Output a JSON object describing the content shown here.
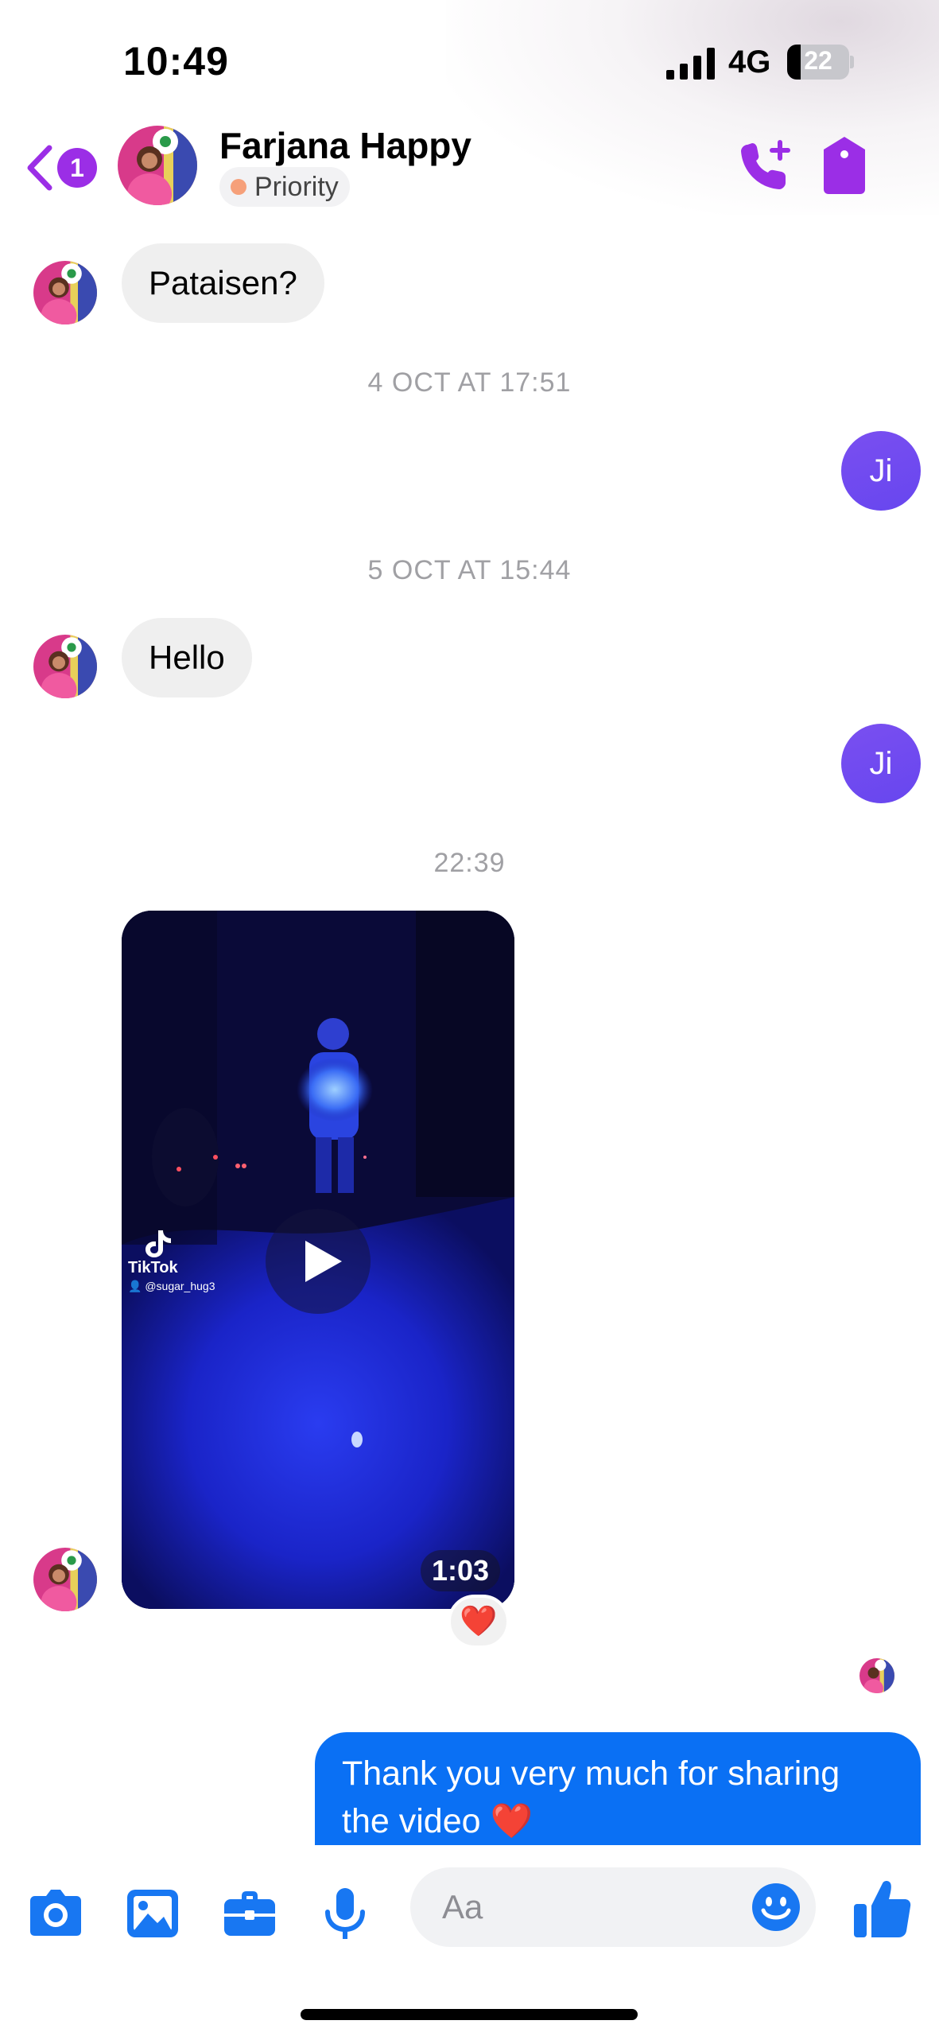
{
  "status_bar": {
    "time": "10:49",
    "network": "4G",
    "battery": "22",
    "battery_level": 0.22
  },
  "header": {
    "back_badge": "1",
    "contact_name": "Farjana Happy",
    "chip": "Priority",
    "actions": [
      "phone-add-icon",
      "shield-icon"
    ]
  },
  "messages": {
    "incoming_1": "Pataisen?",
    "timestamp_1": "4 OCT AT 17:51",
    "outgoing_avatar_1": "Ji",
    "timestamp_2": "5 OCT AT 15:44",
    "incoming_2": "Hello",
    "outgoing_avatar_2": "Ji",
    "timestamp_3": "22:39",
    "video": {
      "watermark": "TikTok",
      "handle": "@sugar_hug3",
      "duration": "1:03",
      "reaction": "❤️"
    },
    "outgoing_text": "Thank you very much for sharing the video ❤️"
  },
  "composer": {
    "placeholder": "Aa",
    "tools": [
      "camera-icon",
      "gallery-icon",
      "briefcase-icon",
      "microphone-icon"
    ],
    "emoji": "smiley-icon",
    "send": "thumbs-up-icon"
  },
  "colors": {
    "accent_purple": "#9b2ee6",
    "outgoing_bubble": "#0a70f4",
    "incoming_bubble": "#efefef",
    "toolbar_blue": "#1877f2"
  }
}
